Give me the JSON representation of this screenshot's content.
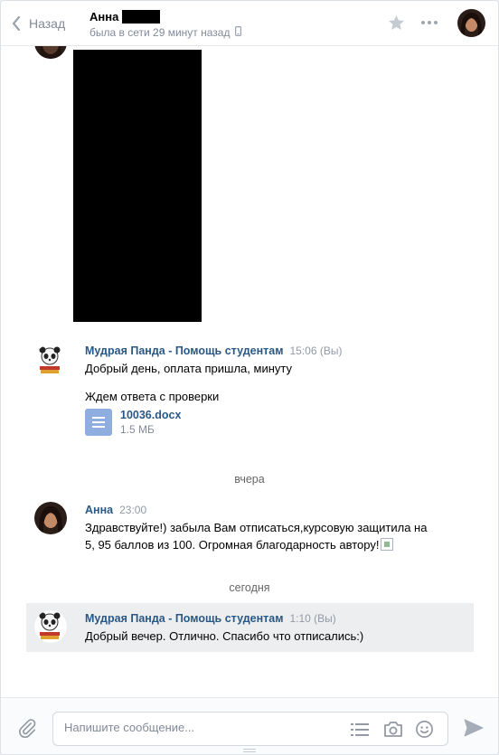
{
  "header": {
    "back_label": "Назад",
    "peer_name": "Анна",
    "peer_status": "была в сети 29 минут назад"
  },
  "messages": [
    {
      "author": "Мудрая Панда - Помощь студентам",
      "time": "15:06 (Вы)",
      "lines": [
        "Добрый день, оплата пришла, минуту",
        "Ждем ответа с проверки"
      ],
      "doc": {
        "name": "10036.docx",
        "size": "1.5 МБ"
      }
    },
    {
      "date_separator": "вчера",
      "author": "Анна",
      "time": "23:00",
      "text_line1": "Здравствуйте!) забыла Вам отписаться,курсовую защитила на",
      "text_line2": "5, 95 баллов из 100. Огромная благодарность автору!"
    },
    {
      "date_separator": "сегодня",
      "author": "Мудрая Панда - Помощь студентам",
      "time": "1:10 (Вы)",
      "text": "Добрый вечер. Отлично. Спасибо что отписались:)"
    }
  ],
  "composer": {
    "placeholder": "Напишите сообщение..."
  },
  "colors": {
    "link": "#2a5885",
    "muted": "#828a99",
    "doc_icon": "#8eaee0",
    "highlight_bg": "#edeef0"
  },
  "icons": [
    "back-chevron-icon",
    "mobile-icon",
    "star-icon",
    "more-icon",
    "attach-icon",
    "template-list-icon",
    "camera-icon",
    "emoji-icon",
    "send-icon",
    "document-icon"
  ]
}
